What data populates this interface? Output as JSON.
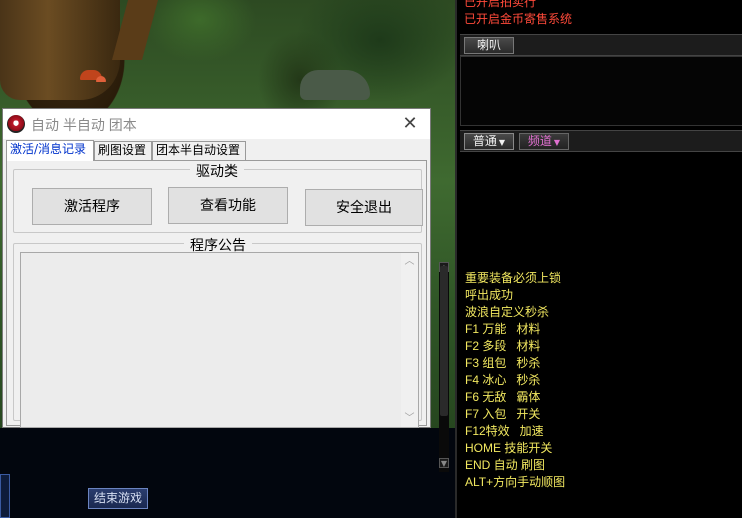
{
  "game": {
    "end_game_label": "结束游戏"
  },
  "chat": {
    "system_messages": [
      "已开启拍卖行",
      "已开启金币寄售系统"
    ],
    "tab_horn": "喇叭",
    "tab_common": "普通",
    "tab_channel": "频道",
    "lines": [
      "重要装备必须上锁",
      "呼出成功",
      "波浪自定义秒杀",
      "F1 万能   材料",
      "F2 多段   材料",
      "F3 组包   秒杀",
      "F4 冰心   秒杀",
      "F6 无敌   霸体",
      "F7 入包   开关",
      "F12特效   加速",
      "HOME 技能开关",
      "END 自动 刷图",
      "ALT+方向手动顺图"
    ]
  },
  "dialog": {
    "title": "自动 半自动 团本",
    "close_label": "✕",
    "tabs": [
      {
        "label": "激活/消息记录",
        "active": true
      },
      {
        "label": "刷图设置",
        "active": false
      },
      {
        "label": "团本半自动设置",
        "active": false
      }
    ],
    "driver_group_title": "驱动类",
    "buttons": {
      "activate": "激活程序",
      "view": "查看功能",
      "exit": "安全退出"
    },
    "notice_group_title": "程序公告",
    "notice_text": ""
  }
}
